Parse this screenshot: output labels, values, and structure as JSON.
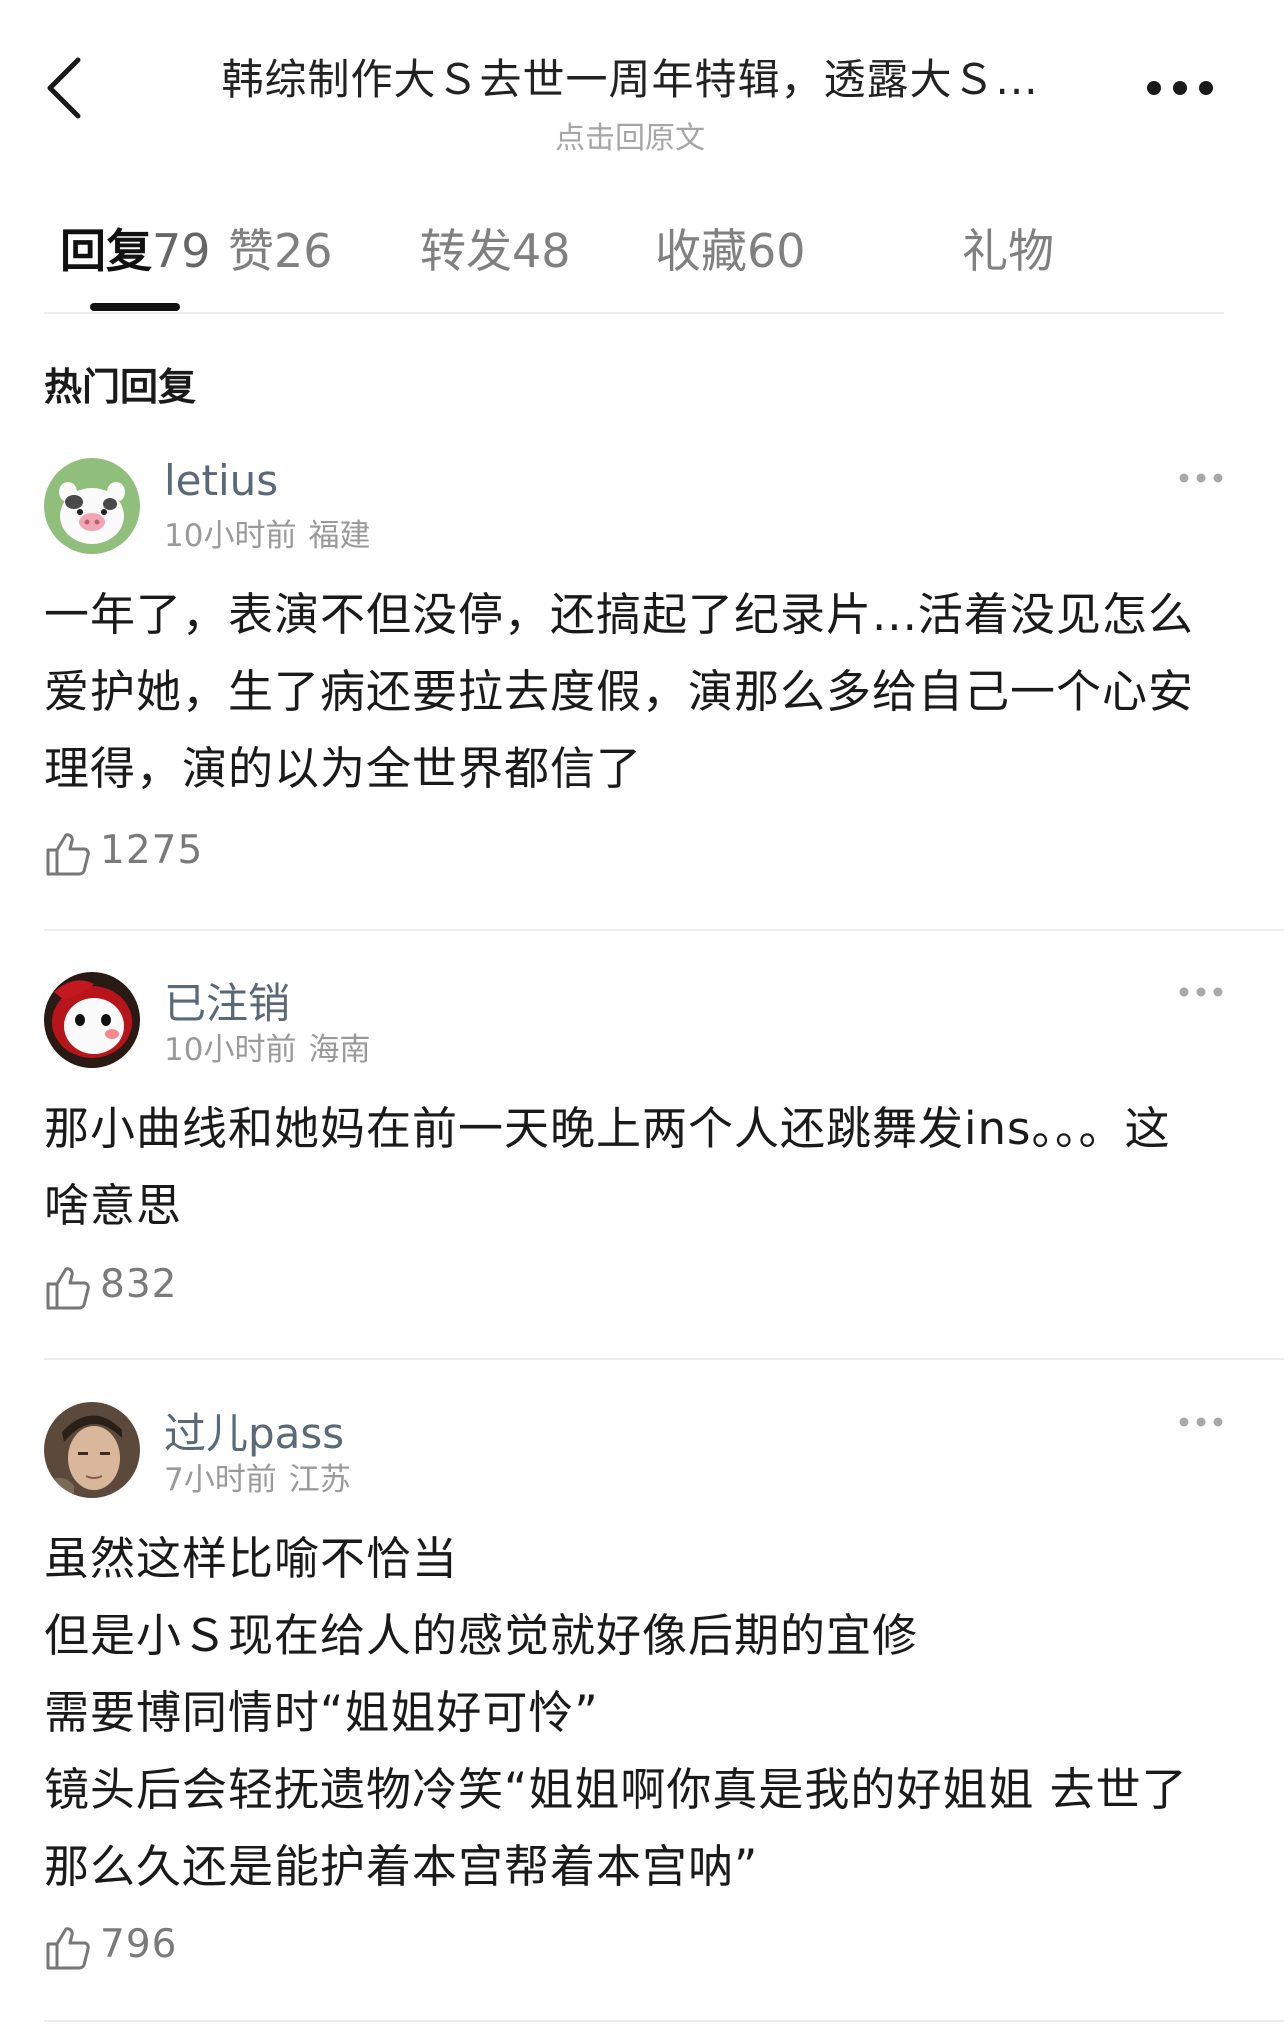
{
  "header": {
    "title": "韩综制作大Ｓ去世一周年特辑，透露大Ｓ...",
    "subtitle": "点击回原文",
    "back_icon": "chevron-left-icon",
    "more_icon": "more-dots-icon"
  },
  "tabs": [
    {
      "label": "回复",
      "count": "79",
      "active": true
    },
    {
      "label": "赞",
      "count": "26",
      "active": false
    },
    {
      "label": "转发",
      "count": "48",
      "active": false
    },
    {
      "label": "收藏",
      "count": "60",
      "active": false
    },
    {
      "label": "礼物",
      "count": "",
      "active": false
    }
  ],
  "section_title": "热门回复",
  "comments": [
    {
      "username": "letius",
      "time": "10小时前",
      "location": "福建",
      "avatar": "pig-cartoon-avatar",
      "lines": [
        "一年了，表演不但没停，还搞起了纪录片...活着没见怎么",
        "爱护她，生了病还要拉去度假，演那么多给自己一个心安",
        "理得，演的以为全世界都信了"
      ],
      "likes": "1275"
    },
    {
      "username": "已注销",
      "time": "10小时前",
      "location": "海南",
      "avatar": "red-mascot-avatar",
      "lines": [
        "那小曲线和她妈在前一天晚上两个人还跳舞发ins。。。这",
        "啥意思"
      ],
      "likes": "832"
    },
    {
      "username": "过儿pass",
      "time": "7小时前",
      "location": "江苏",
      "avatar": "person-photo-avatar",
      "lines": [
        "虽然这样比喻不恰当",
        "但是小Ｓ现在给人的感觉就好像后期的宜修",
        "需要博同情时“姐姐好可怜”",
        "镜头后会轻抚遗物冷笑“姐姐啊你真是我的好姐姐 去世了",
        "那么久还是能护着本宫帮着本宫呐”"
      ],
      "likes": "796"
    }
  ],
  "colors": {
    "username": "#5a6878",
    "meta": "#9a9a9a",
    "text": "#1a1a1a",
    "tab_active": "#111111",
    "tab_inactive": "#808080"
  }
}
